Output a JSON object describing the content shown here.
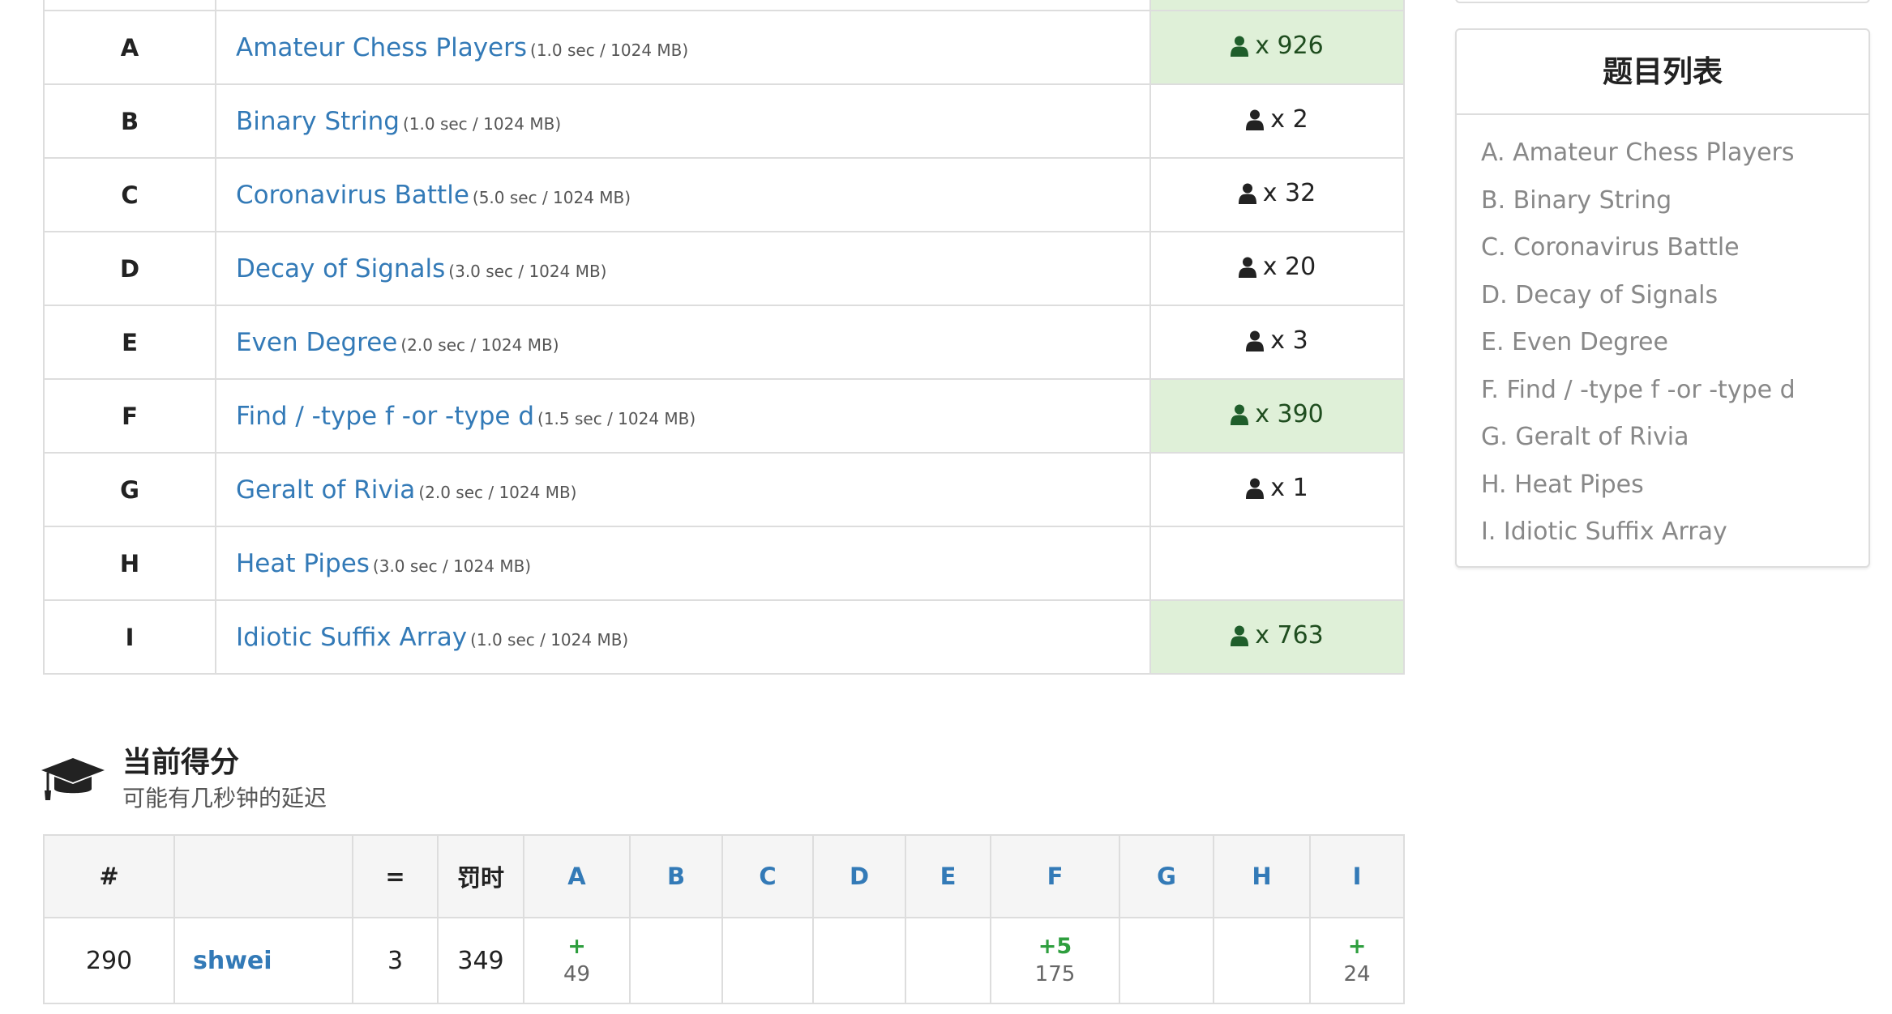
{
  "problems": [
    {
      "letter": "A",
      "title": "Amateur Chess Players",
      "limit": "(1.0 sec / 1024 MB)",
      "solved": "x 926",
      "accepted": true
    },
    {
      "letter": "B",
      "title": "Binary String",
      "limit": "(1.0 sec / 1024 MB)",
      "solved": "x 2",
      "accepted": false
    },
    {
      "letter": "C",
      "title": "Coronavirus Battle",
      "limit": "(5.0 sec / 1024 MB)",
      "solved": "x 32",
      "accepted": false
    },
    {
      "letter": "D",
      "title": "Decay of Signals",
      "limit": "(3.0 sec / 1024 MB)",
      "solved": "x 20",
      "accepted": false
    },
    {
      "letter": "E",
      "title": "Even Degree",
      "limit": "(2.0 sec / 1024 MB)",
      "solved": "x 3",
      "accepted": false
    },
    {
      "letter": "F",
      "title": "Find / -type f -or -type d",
      "limit": "(1.5 sec / 1024 MB)",
      "solved": "x 390",
      "accepted": true
    },
    {
      "letter": "G",
      "title": "Geralt of Rivia",
      "limit": "(2.0 sec / 1024 MB)",
      "solved": "x 1",
      "accepted": false
    },
    {
      "letter": "H",
      "title": "Heat Pipes",
      "limit": "(3.0 sec / 1024 MB)",
      "solved": "",
      "accepted": false
    },
    {
      "letter": "I",
      "title": "Idiotic Suffix Array",
      "limit": "(1.0 sec / 1024 MB)",
      "solved": "x 763",
      "accepted": true
    }
  ],
  "sidebar": {
    "heading": "题目列表",
    "items": [
      "A. Amateur Chess Players",
      "B. Binary String",
      "C. Coronavirus Battle",
      "D. Decay of Signals",
      "E. Even Degree",
      "F. Find / -type f -or -type d",
      "G. Geralt of Rivia",
      "H. Heat Pipes",
      "I. Idiotic Suffix Array"
    ]
  },
  "score": {
    "icon": "graduation-cap-icon",
    "title": "当前得分",
    "subtitle": "可能有几秒钟的延迟"
  },
  "standings": {
    "headers": {
      "rank": "#",
      "name": "",
      "solved": "=",
      "penalty": "罚时"
    },
    "problem_letters": [
      "A",
      "B",
      "C",
      "D",
      "E",
      "F",
      "G",
      "H",
      "I"
    ],
    "row": {
      "rank": "290",
      "user": "shwei",
      "solved": "3",
      "penalty": "349",
      "results": [
        {
          "top": "+",
          "bottom": "49"
        },
        {
          "top": "",
          "bottom": ""
        },
        {
          "top": "",
          "bottom": ""
        },
        {
          "top": "",
          "bottom": ""
        },
        {
          "top": "",
          "bottom": ""
        },
        {
          "top": "+5",
          "bottom": "175"
        },
        {
          "top": "",
          "bottom": ""
        },
        {
          "top": "",
          "bottom": ""
        },
        {
          "top": "+",
          "bottom": "24"
        }
      ]
    }
  },
  "colors": {
    "link": "#337ab7",
    "accepted_bg": "#dff0d8",
    "plus_green": "#2e9e3e",
    "border": "#dddddd"
  }
}
